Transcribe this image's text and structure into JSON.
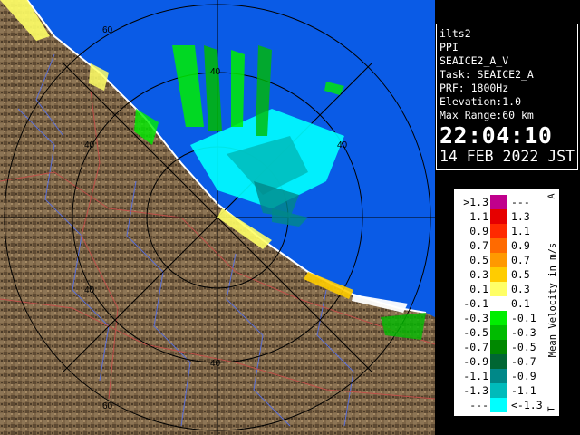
{
  "info": {
    "site": "ilts2",
    "product": "PPI",
    "scan": "SEAICE2_A_V",
    "task": "Task: SEAICE2_A",
    "prf": "PRF: 1800Hz",
    "elevation": "Elevation:1.0",
    "range": "Max Range:60 km",
    "time": "22:04:10",
    "date": "14 FEB 2022 JST"
  },
  "range_rings": {
    "labels": [
      "60",
      "40",
      "40",
      "40",
      "40",
      "40",
      "60"
    ]
  },
  "legend": {
    "title": "Mean Velocity in m/s",
    "corner_top": "A",
    "corner_bottom": "T",
    "rows": [
      {
        "left": ">1.3",
        "right": "---",
        "color": "#c0008c"
      },
      {
        "left": "1.1",
        "right": "1.3",
        "color": "#e60000"
      },
      {
        "left": "0.9",
        "right": "1.1",
        "color": "#ff2a00"
      },
      {
        "left": "0.7",
        "right": "0.9",
        "color": "#ff6a00"
      },
      {
        "left": "0.5",
        "right": "0.7",
        "color": "#ff9900"
      },
      {
        "left": "0.3",
        "right": "0.5",
        "color": "#ffcc00"
      },
      {
        "left": "0.1",
        "right": "0.3",
        "color": "#ffff66"
      },
      {
        "left": "-0.1",
        "right": "0.1",
        "color": "#ffffff"
      },
      {
        "left": "-0.3",
        "right": "-0.1",
        "color": "#00ee00"
      },
      {
        "left": "-0.5",
        "right": "-0.3",
        "color": "#00bb00"
      },
      {
        "left": "-0.7",
        "right": "-0.5",
        "color": "#008800"
      },
      {
        "left": "-0.9",
        "right": "-0.7",
        "color": "#006633"
      },
      {
        "left": "-1.1",
        "right": "-0.9",
        "color": "#008888"
      },
      {
        "left": "-1.3",
        "right": "-1.1",
        "color": "#00bbbb"
      },
      {
        "left": "---",
        "right": "<-1.3",
        "color": "#00ffff"
      }
    ]
  },
  "colors": {
    "sea": "#0a5be6",
    "land": "#7d6547",
    "rings": "#000000",
    "coast": "#ffffff"
  }
}
